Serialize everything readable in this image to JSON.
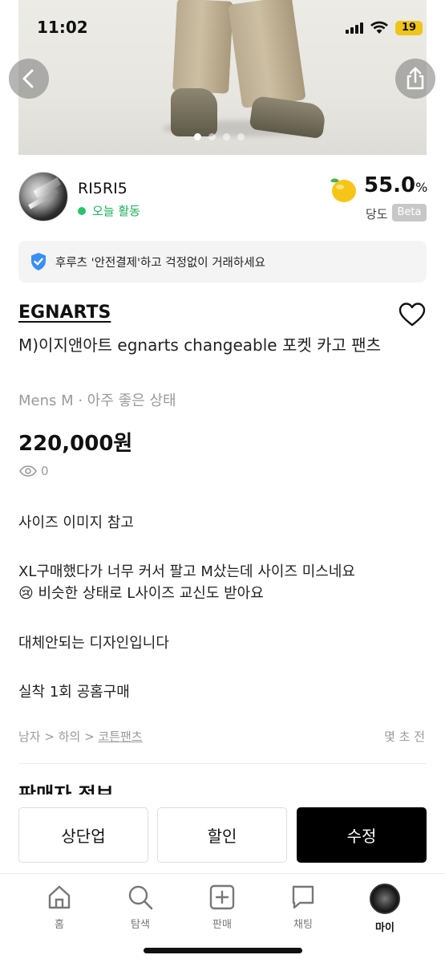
{
  "status_bar": {
    "time": "11:02",
    "battery": "19"
  },
  "hero": {
    "image_count": 4,
    "active_index": 0
  },
  "seller": {
    "name": "RI5RI5",
    "activity": "오늘 활동",
    "score": "55.0",
    "score_unit": "%",
    "score_label": "당도",
    "beta": "Beta"
  },
  "notice": "후루츠 '안전결제'하고 걱정없이 거래하세요",
  "product": {
    "brand": "EGNARTS",
    "title": "M)이지앤아트 egnarts changeable 포켓 카고 팬츠",
    "subtitle": "Mens M · 아주 좋은 상태",
    "price": "220,000원",
    "views": "0"
  },
  "description": [
    "사이즈 이미지 참고",
    "XL구매했다가 너무 커서 팔고 M샀는데 사이즈 미스네요",
    "😢 비슷한 상태로 L사이즈 교신도 받아요",
    "대체안되는 디자인입니다",
    "실착 1회 공홈구매"
  ],
  "breadcrumb": {
    "c1": "남자",
    "c2": "하의",
    "c3": "코튼팬츠",
    "sep": " > "
  },
  "posted": "몇 초 전",
  "seller_section_title": "판매자 정보",
  "actions": {
    "bump": "상단업",
    "discount": "할인",
    "edit": "수정"
  },
  "tabs": {
    "home": "홈",
    "search": "탐색",
    "sell": "판매",
    "chat": "채팅",
    "me": "마이"
  },
  "colors": {
    "accent_green": "#1fae5b",
    "dark_button": "#000000",
    "fruit_yellow": "#f5c518"
  }
}
